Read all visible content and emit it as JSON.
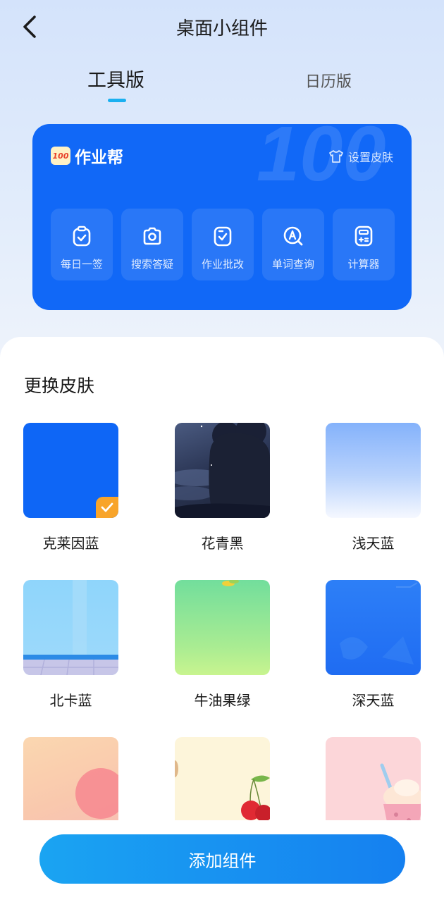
{
  "header": {
    "title": "桌面小组件"
  },
  "tabs": [
    {
      "label": "工具版",
      "active": true
    },
    {
      "label": "日历版",
      "active": false
    }
  ],
  "widget": {
    "brand_logo": "100",
    "brand_name": "作业帮",
    "skin_setting": "设置皮肤",
    "tools": [
      {
        "label": "每日一签",
        "icon": "clipboard-check-icon"
      },
      {
        "label": "搜索答疑",
        "icon": "camera-icon"
      },
      {
        "label": "作业批改",
        "icon": "homework-check-icon"
      },
      {
        "label": "单词查询",
        "icon": "word-search-icon"
      },
      {
        "label": "计算器",
        "icon": "calculator-icon"
      }
    ],
    "accent": "#1168f7"
  },
  "skins": {
    "title": "更换皮肤",
    "selected": "克莱因蓝",
    "items": [
      {
        "label": "克莱因蓝"
      },
      {
        "label": "花青黑"
      },
      {
        "label": "浅天蓝"
      },
      {
        "label": "北卡蓝"
      },
      {
        "label": "牛油果绿"
      },
      {
        "label": "深天蓝"
      },
      {
        "label": ""
      },
      {
        "label": ""
      },
      {
        "label": ""
      }
    ]
  },
  "actions": {
    "add_label": "添加组件"
  }
}
